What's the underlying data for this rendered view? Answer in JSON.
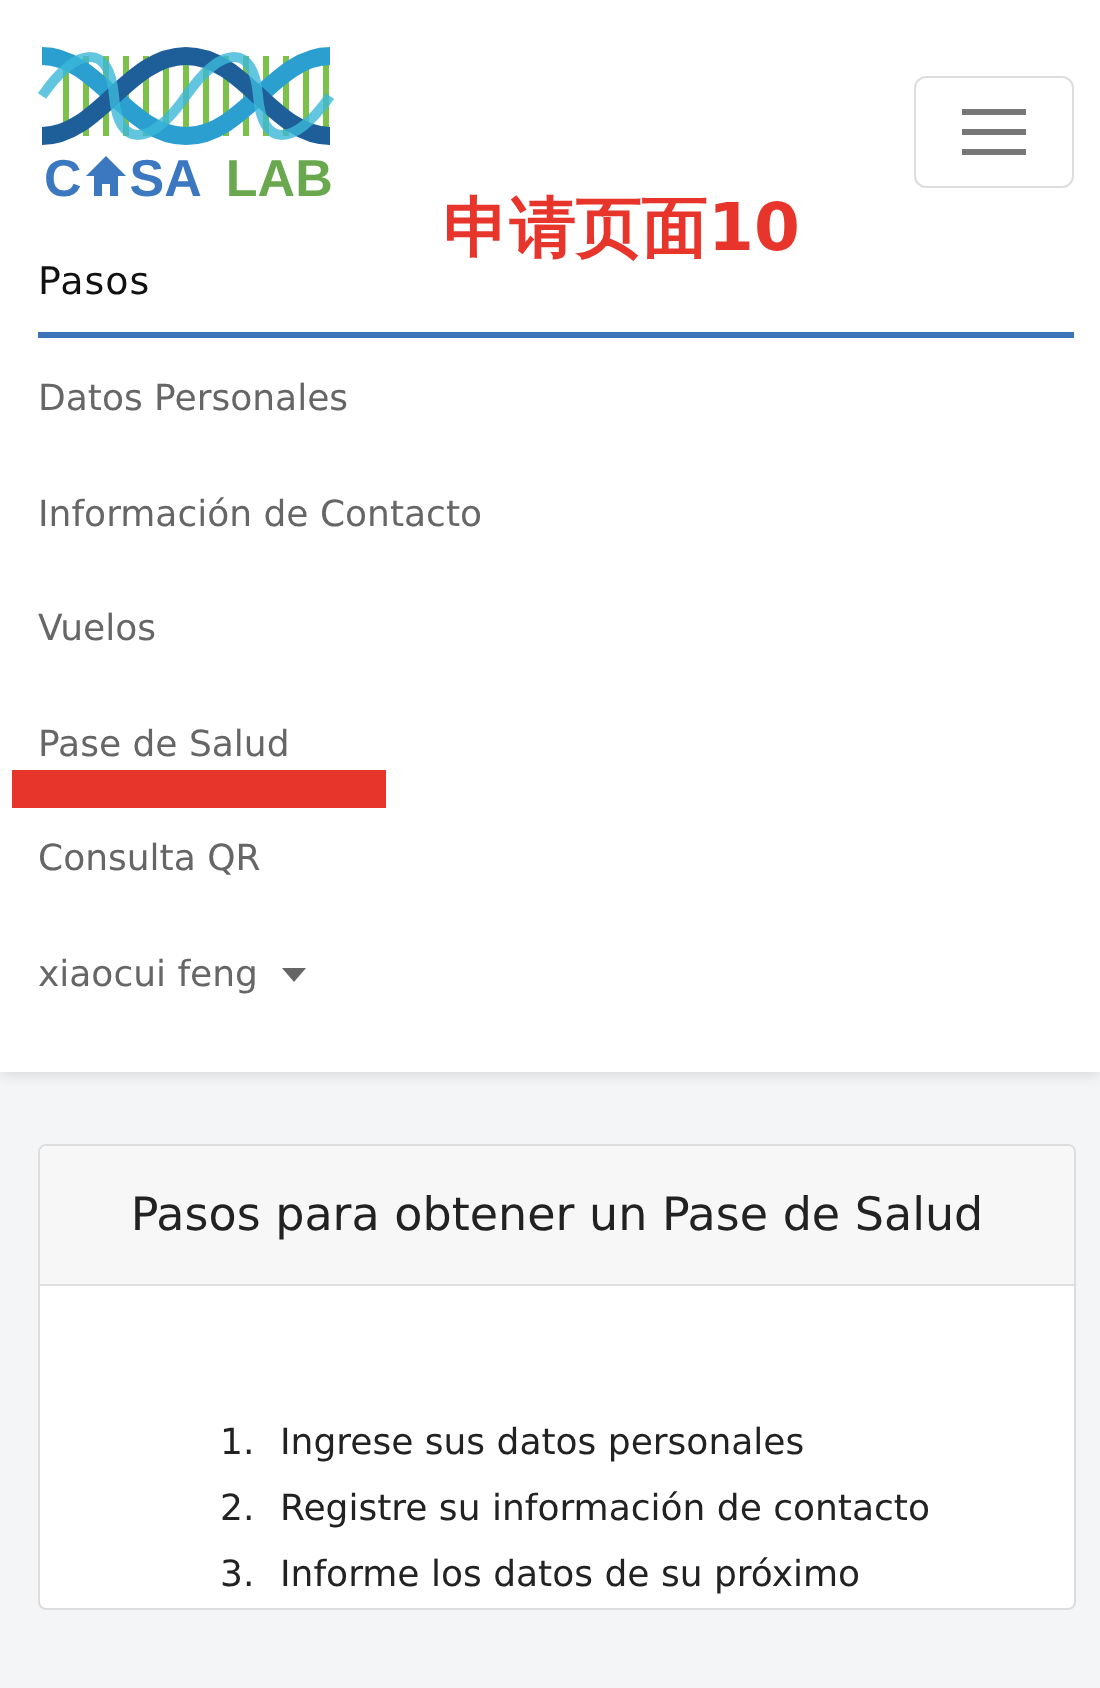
{
  "brand": {
    "left": [
      "C",
      "SA"
    ],
    "right": "LAB"
  },
  "annotation": "申请页面10",
  "nav_heading": "Pasos",
  "nav_items": [
    {
      "label": "Datos Personales",
      "kind": "link",
      "underlined": false
    },
    {
      "label": "Información de Contacto",
      "kind": "link",
      "underlined": false
    },
    {
      "label": "Vuelos",
      "kind": "link",
      "underlined": false
    },
    {
      "label": "Pase de Salud",
      "kind": "link",
      "underlined": true
    },
    {
      "label": "Consulta QR",
      "kind": "link",
      "underlined": false
    },
    {
      "label": "xiaocui feng",
      "kind": "dropdown",
      "underlined": false
    }
  ],
  "card": {
    "title": "Pasos para obtener un Pase de Salud",
    "steps": [
      {
        "number": "1.",
        "text": "Ingrese sus datos personales"
      },
      {
        "number": "2.",
        "text": "Registre su información de contacto"
      },
      {
        "number": "3.",
        "text": "Informe los datos de su próximo"
      }
    ]
  }
}
